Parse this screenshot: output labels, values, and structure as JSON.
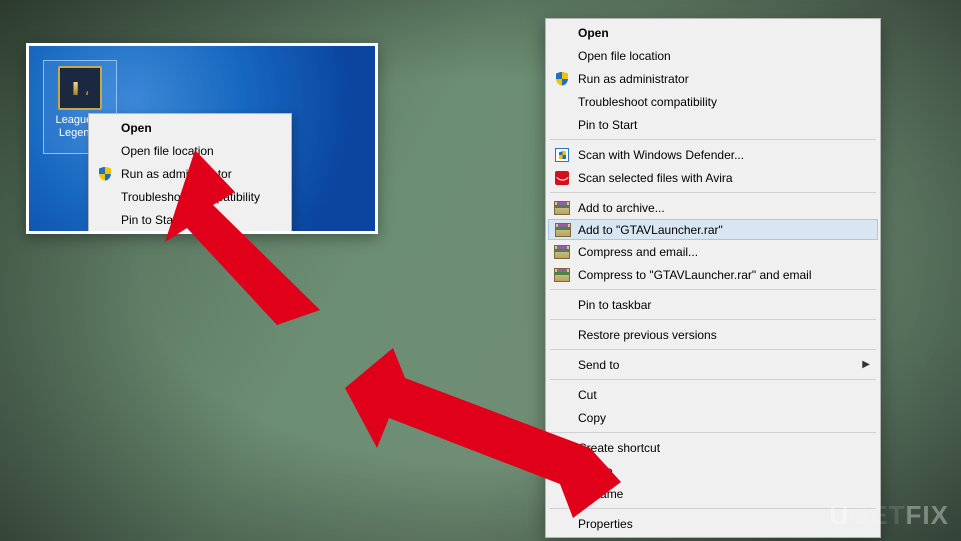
{
  "desktop_icon": {
    "letter": "L",
    "label_line1": "League of",
    "label_line2": "Legends"
  },
  "menu_a": {
    "open": "Open",
    "open_file_location": "Open file location",
    "run_admin": "Run as administrator",
    "troubleshoot": "Troubleshoot compatibility",
    "pin_start": "Pin to Start"
  },
  "menu_b": {
    "open": "Open",
    "open_file_location": "Open file location",
    "run_admin": "Run as administrator",
    "troubleshoot": "Troubleshoot compatibility",
    "pin_start": "Pin to Start",
    "scan_defender": "Scan with Windows Defender...",
    "scan_avira": "Scan selected files with Avira",
    "add_archive": "Add to archive...",
    "add_to_rar": "Add to \"GTAVLauncher.rar\"",
    "compress_email": "Compress and email...",
    "compress_rar_email": "Compress to \"GTAVLauncher.rar\" and email",
    "pin_taskbar": "Pin to taskbar",
    "restore": "Restore previous versions",
    "send_to": "Send to",
    "cut": "Cut",
    "copy": "Copy",
    "create_shortcut": "Create shortcut",
    "delete": "Delete",
    "rename": "Rename",
    "properties": "Properties"
  },
  "watermark": {
    "prefix": "U",
    "mid": "GET",
    "suffix": "FIX"
  }
}
